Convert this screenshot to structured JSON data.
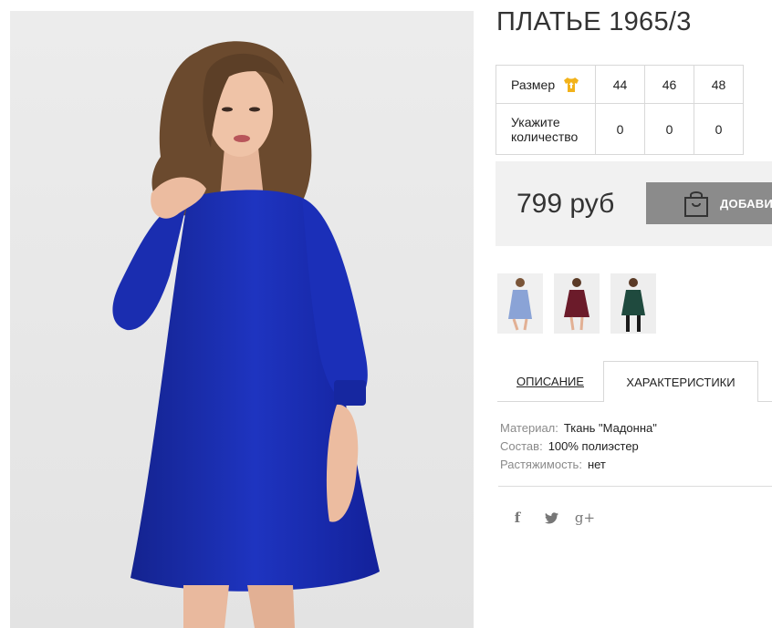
{
  "product": {
    "title": "ПЛАТЬЕ 1965/3",
    "main_image": "blue-dress-model-photo"
  },
  "size_table": {
    "size_label": "Размер",
    "size_icon": "tshirt-icon",
    "icon_color": "#f2b21a",
    "qty_label_line1": "Укажите",
    "qty_label_line2": "количество",
    "sizes": [
      "44",
      "46",
      "48"
    ],
    "quantities": [
      "0",
      "0",
      "0"
    ]
  },
  "purchase": {
    "price": "799 руб",
    "add_button": "ДОБАВИТЬ",
    "button_color": "#8b8b8b"
  },
  "thumbnails": [
    {
      "name": "light-blue-dress-thumb",
      "color": "#8aa3d6"
    },
    {
      "name": "burgundy-dress-thumb",
      "color": "#6b1b2a"
    },
    {
      "name": "green-dress-thumb",
      "color": "#1f4a3e"
    }
  ],
  "tabs": {
    "description": "ОПИСАНИЕ",
    "characteristics": "ХАРАКТЕРИСТИКИ",
    "active": "characteristics"
  },
  "characteristics": [
    {
      "key": "Материал:",
      "value": "Ткань \"Мадонна\""
    },
    {
      "key": "Состав:",
      "value": "100% полиэстер"
    },
    {
      "key": "Растяжимость:",
      "value": "нет"
    }
  ],
  "social": {
    "facebook": "f",
    "twitter": "twitter-icon",
    "googleplus": "g+"
  },
  "colors": {
    "dress_blue": "#1a2fb0",
    "text_dark": "#333333",
    "muted": "#8a8a8a"
  }
}
